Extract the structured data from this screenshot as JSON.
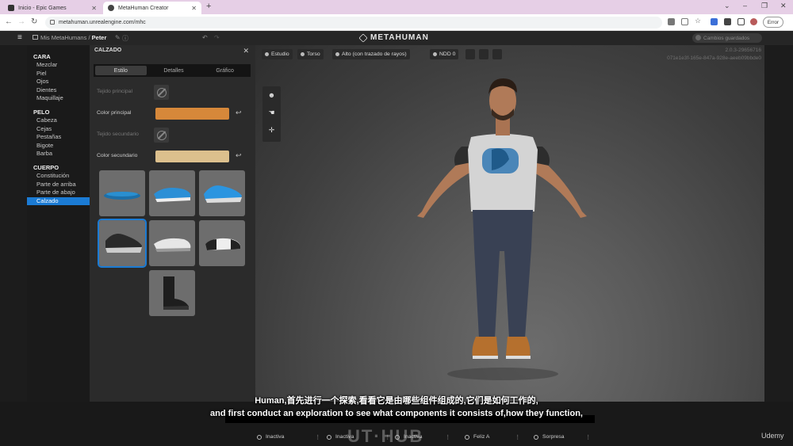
{
  "browser": {
    "tabs": [
      {
        "label": "Inicio - Epic Games"
      },
      {
        "label": "MetaHuman Creator"
      }
    ],
    "new_tab": "+",
    "url": "metahuman.unrealengine.com/mhc",
    "error_button": "Error"
  },
  "app": {
    "breadcrumb_root": "Mis MetaHumans",
    "breadcrumb_sep": "/",
    "breadcrumb_current": "Peter",
    "logo": "METAHUMAN",
    "save_status": "Cambios guardados"
  },
  "nav": {
    "sections": [
      {
        "title": "CARA",
        "items": [
          {
            "label": "Mezclar"
          },
          {
            "label": "Piel"
          },
          {
            "label": "Ojos"
          },
          {
            "label": "Dientes"
          },
          {
            "label": "Maquillaje"
          }
        ]
      },
      {
        "title": "PELO",
        "items": [
          {
            "label": "Cabeza"
          },
          {
            "label": "Cejas"
          },
          {
            "label": "Pestañas"
          },
          {
            "label": "Bigote"
          },
          {
            "label": "Barba"
          }
        ]
      },
      {
        "title": "CUERPO",
        "items": [
          {
            "label": "Constitución"
          },
          {
            "label": "Parte de arriba"
          },
          {
            "label": "Parte de abajo"
          },
          {
            "label": "Calzado",
            "selected": true
          }
        ]
      }
    ]
  },
  "panel": {
    "title": "CALZADO",
    "tabs": [
      "Estilo",
      "Detalles",
      "Gráfico"
    ],
    "active_tab": "Estilo",
    "rows": {
      "primary_fabric": "Tejido principal",
      "primary_color": "Color principal",
      "secondary_fabric": "Tejido secundario",
      "secondary_color": "Color secundario"
    },
    "colors": {
      "primary": "#d6883a",
      "secondary": "#dcc08d",
      "accent": "#1b7bd4"
    },
    "thumbnails": [
      {
        "name": "sandal",
        "selected": false
      },
      {
        "name": "slip-on-blue",
        "selected": false
      },
      {
        "name": "sneaker-blue",
        "selected": false
      },
      {
        "name": "sneaker-black",
        "selected": true
      },
      {
        "name": "loafer-white",
        "selected": false
      },
      {
        "name": "oxford-black-white",
        "selected": false
      },
      {
        "name": "boot-black",
        "selected": false
      }
    ]
  },
  "viewport": {
    "toolbar": [
      "Estudio",
      "Torso",
      "Alto (con trazado de rayos)",
      "NDD 0"
    ],
    "version": "2.0.3-29656716",
    "session_id": "071e1e3f-165e-847a-928e-aeeb09bbde0"
  },
  "expressions": [
    {
      "label": "Inactiva"
    },
    {
      "label": "Inactiva"
    },
    {
      "label": "Inactiva"
    },
    {
      "label": "Feliz A"
    },
    {
      "label": "Sorpresa"
    }
  ],
  "subtitles": {
    "zh": "Human,首先进行一个探索,看看它是由哪些组件组成的,它们是如何工作的,",
    "en": "and first conduct an exploration to see what components it consists of,how they function,"
  },
  "watermark": "UT·HUB",
  "udemy": "Udemy"
}
